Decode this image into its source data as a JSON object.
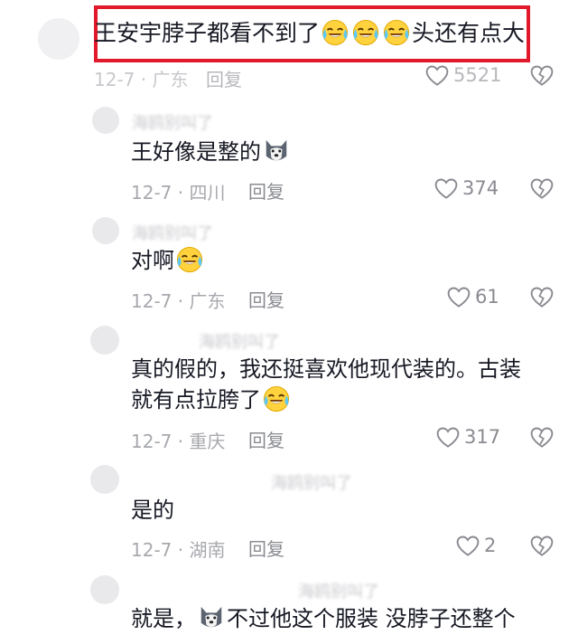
{
  "top_comment": {
    "text_part1": "王安宇脖子都看不到了",
    "text_part2": "头还有点大",
    "meta": "12-7 · 广东",
    "reply_label": "回复",
    "likes": "5521"
  },
  "replies": [
    {
      "username": "海鸥别叫了",
      "text": "王好像是整的",
      "meta": "12-7 · 四川",
      "reply_label": "回复",
      "likes": "374"
    },
    {
      "username": "海鸥别叫了",
      "text": "对啊",
      "meta": "12-7 · 广东",
      "reply_label": "回复",
      "likes": "61"
    },
    {
      "username": "海鸥别叫了",
      "text_line1": "真的假的，我还挺喜欢他现代装的。古装",
      "text_line2": "就有点拉胯了",
      "meta": "12-7 · 重庆",
      "reply_label": "回复",
      "likes": "317"
    },
    {
      "username": "海鸥别叫了",
      "text": "是的",
      "meta": "12-7 · 湖南",
      "reply_label": "回复",
      "likes": "2"
    },
    {
      "username": "海鸥别叫了",
      "text_part1": "就是，",
      "text_part2": "不过他这个服装 没脖子还整个"
    }
  ],
  "colors": {
    "highlight_border": "#e1192b",
    "text": "#161823",
    "muted": "#9b9ca2"
  },
  "icons": [
    "crying-laughing-emoji",
    "husky-emoji",
    "heart-icon",
    "broken-heart-icon"
  ]
}
